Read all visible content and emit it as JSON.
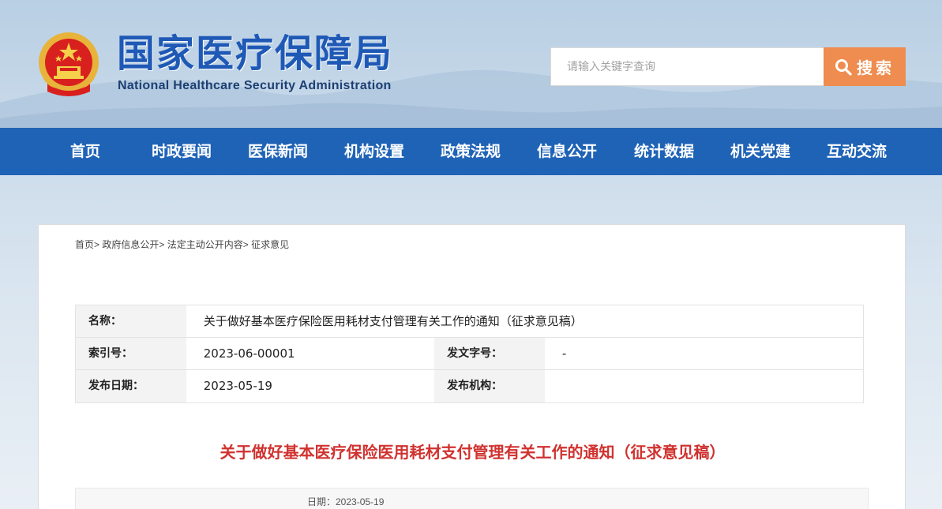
{
  "header": {
    "site_title": "国家医疗保障局",
    "site_title_en": "National Healthcare Security Administration",
    "search_placeholder": "请输入关键字查询",
    "search_button": "搜索"
  },
  "nav": {
    "items": [
      "首页",
      "时政要闻",
      "医保新闻",
      "机构设置",
      "政策法规",
      "信息公开",
      "统计数据",
      "机关党建",
      "互动交流"
    ]
  },
  "breadcrumb": {
    "items": [
      "首页",
      "政府信息公开",
      "法定主动公开内容",
      "征求意见"
    ],
    "separator": ">"
  },
  "info": {
    "name_label": "名称：",
    "name_value": "关于做好基本医疗保险医用耗材支付管理有关工作的通知（征求意见稿）",
    "index_label": "索引号：",
    "index_value": "2023-06-00001",
    "doc_no_label": "发文字号：",
    "doc_no_value": "-",
    "pub_date_label": "发布日期：",
    "pub_date_value": "2023-05-19",
    "pub_org_label": "发布机构：",
    "pub_org_value": ""
  },
  "article": {
    "title": "关于做好基本医疗保险医用耗材支付管理有关工作的通知（征求意见稿）",
    "date_line": "日期：2023-05-19"
  },
  "colors": {
    "nav_bg": "#1f63b6",
    "search_button_bg": "#ef8c4f",
    "title_red": "#d0322f",
    "brand_blue": "#1f59b6"
  }
}
